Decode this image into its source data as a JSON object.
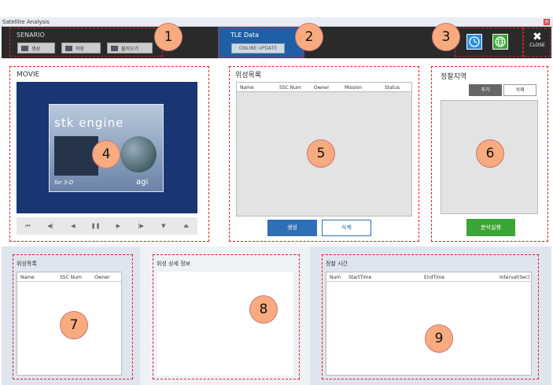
{
  "window": {
    "title": "Satellite Analysis"
  },
  "toolbar": {
    "scenario_label": "SENARIO",
    "buttons": [
      "생성",
      "저장",
      "불러오기"
    ],
    "tle_label": "TLE Data",
    "online_update": "ONLINE UPDATE",
    "close_label": "CLOSE"
  },
  "badges": [
    "1",
    "2",
    "3",
    "4",
    "5",
    "6",
    "7",
    "8",
    "9"
  ],
  "movie": {
    "title": "MOVIE",
    "splash_title": "stk engine",
    "splash_sub": "for 3-D",
    "splash_brand": "agi"
  },
  "satellite_list": {
    "title": "위성목록",
    "columns": [
      "Name",
      "SSC Num",
      "Owner",
      "Mission",
      "Status"
    ],
    "create": "생성",
    "delete": "삭제"
  },
  "recon_area": {
    "title": "정찰지역",
    "add": "추가",
    "delete": "삭제",
    "run": "분석실행"
  },
  "bottom_list": {
    "title": "위성목록",
    "columns": [
      "Name",
      "SSC Num",
      "Owner"
    ]
  },
  "detail": {
    "title": "위성 상세 정보"
  },
  "recon_time": {
    "title": "정찰 시간",
    "columns": [
      "Num",
      "StartTime",
      "EndTime",
      "Interval(Sec)"
    ]
  },
  "colors": {
    "toolbar": "#2a2a2a",
    "tle": "#1f5fa6",
    "accent_blue": "#2f6fb5",
    "run_green": "#3aa635",
    "badge": "#f7ab7f"
  }
}
